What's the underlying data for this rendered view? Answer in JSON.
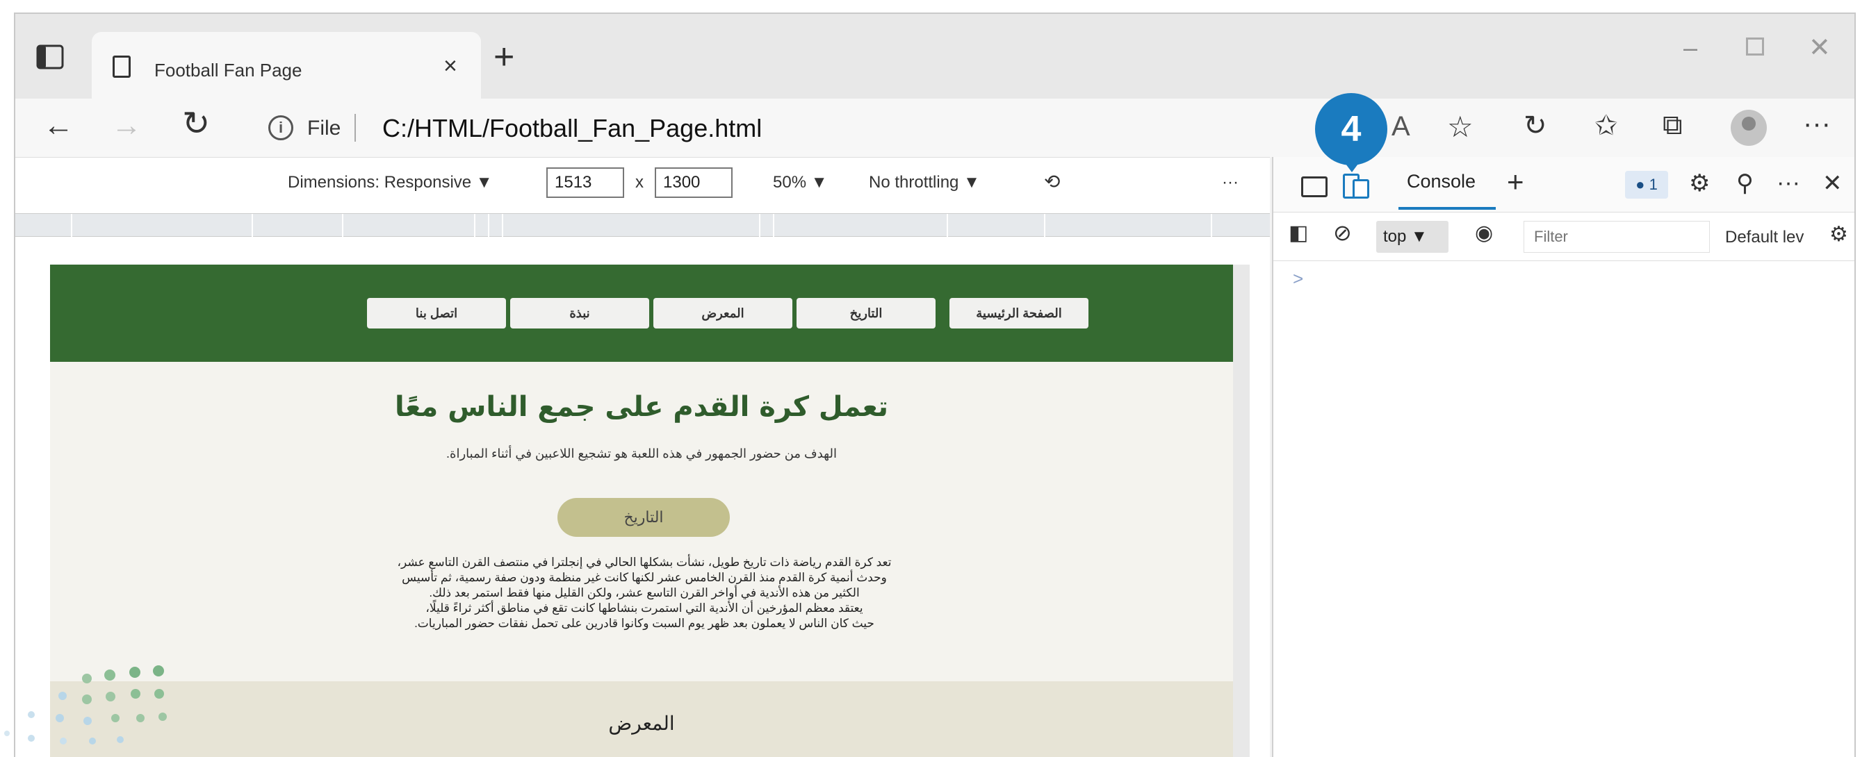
{
  "browser": {
    "tab_title": "Football Fan Page",
    "tab_close": "×",
    "new_tab": "+",
    "address": {
      "prefix_label": "File",
      "url": "C:/HTML/Football_Fan_Page.html"
    },
    "window_controls": {
      "minimize": "–",
      "close": "✕"
    }
  },
  "callout": {
    "number": "4",
    "color": "#1a7bbf"
  },
  "device_toolbar": {
    "dimensions_label": "Dimensions: Responsive ▼",
    "width": "1513",
    "x_sep": "x",
    "height": "1300",
    "zoom": "50% ▼",
    "throttling": "No throttling ▼",
    "more": "···"
  },
  "site": {
    "nav": [
      "الصفحة الرئيسية",
      "التاريخ",
      "المعرض",
      "نبذة",
      "اتصل بنا"
    ],
    "hero_title": "تعمل كرة القدم على جمع الناس معًا",
    "hero_subtitle": "الهدف من حضور الجمهور في هذه اللعبة هو تشجيع اللاعبين في أثناء المباراة.",
    "history_button": "التاريخ",
    "history_lines": [
      "تعد كرة القدم رياضة ذات تاريخ طويل، نشأت بشكلها الحالي في إنجلترا في منتصف القرن التاسع عشر،",
      "وحدث أنمية كرة القدم منذ القرن الخامس عشر لكنها كانت غير منظمة ودون صفة رسمية، ثم تأسيس",
      "الكثير من هذه الأندية في أواخر القرن التاسع عشر، ولكن القليل منها فقط استمر بعد ذلك.",
      "يعتقد معظم المؤرخين أن الأندية التي استمرت بنشاطها كانت تقع في مناطق أكثر ثراءً قليلًا،",
      "حيث كان الناس لا يعملون بعد ظهر يوم السبت وكانوا قادرين على تحمل نفقات حضور المباريات."
    ],
    "gallery_title": "المعرض",
    "colors": {
      "nav_green": "#356a31",
      "title_green": "#2f5c2c",
      "history_btn": "#c3c08e",
      "gallery_bg": "#e7e4d6"
    }
  },
  "devtools": {
    "console_tab": "Console",
    "add_tab": "+",
    "issues_badge": "● 1",
    "context": "top ▼",
    "filter_placeholder": "Filter",
    "levels": "Default lev",
    "prompt": ">",
    "close": "✕",
    "more": "···"
  }
}
